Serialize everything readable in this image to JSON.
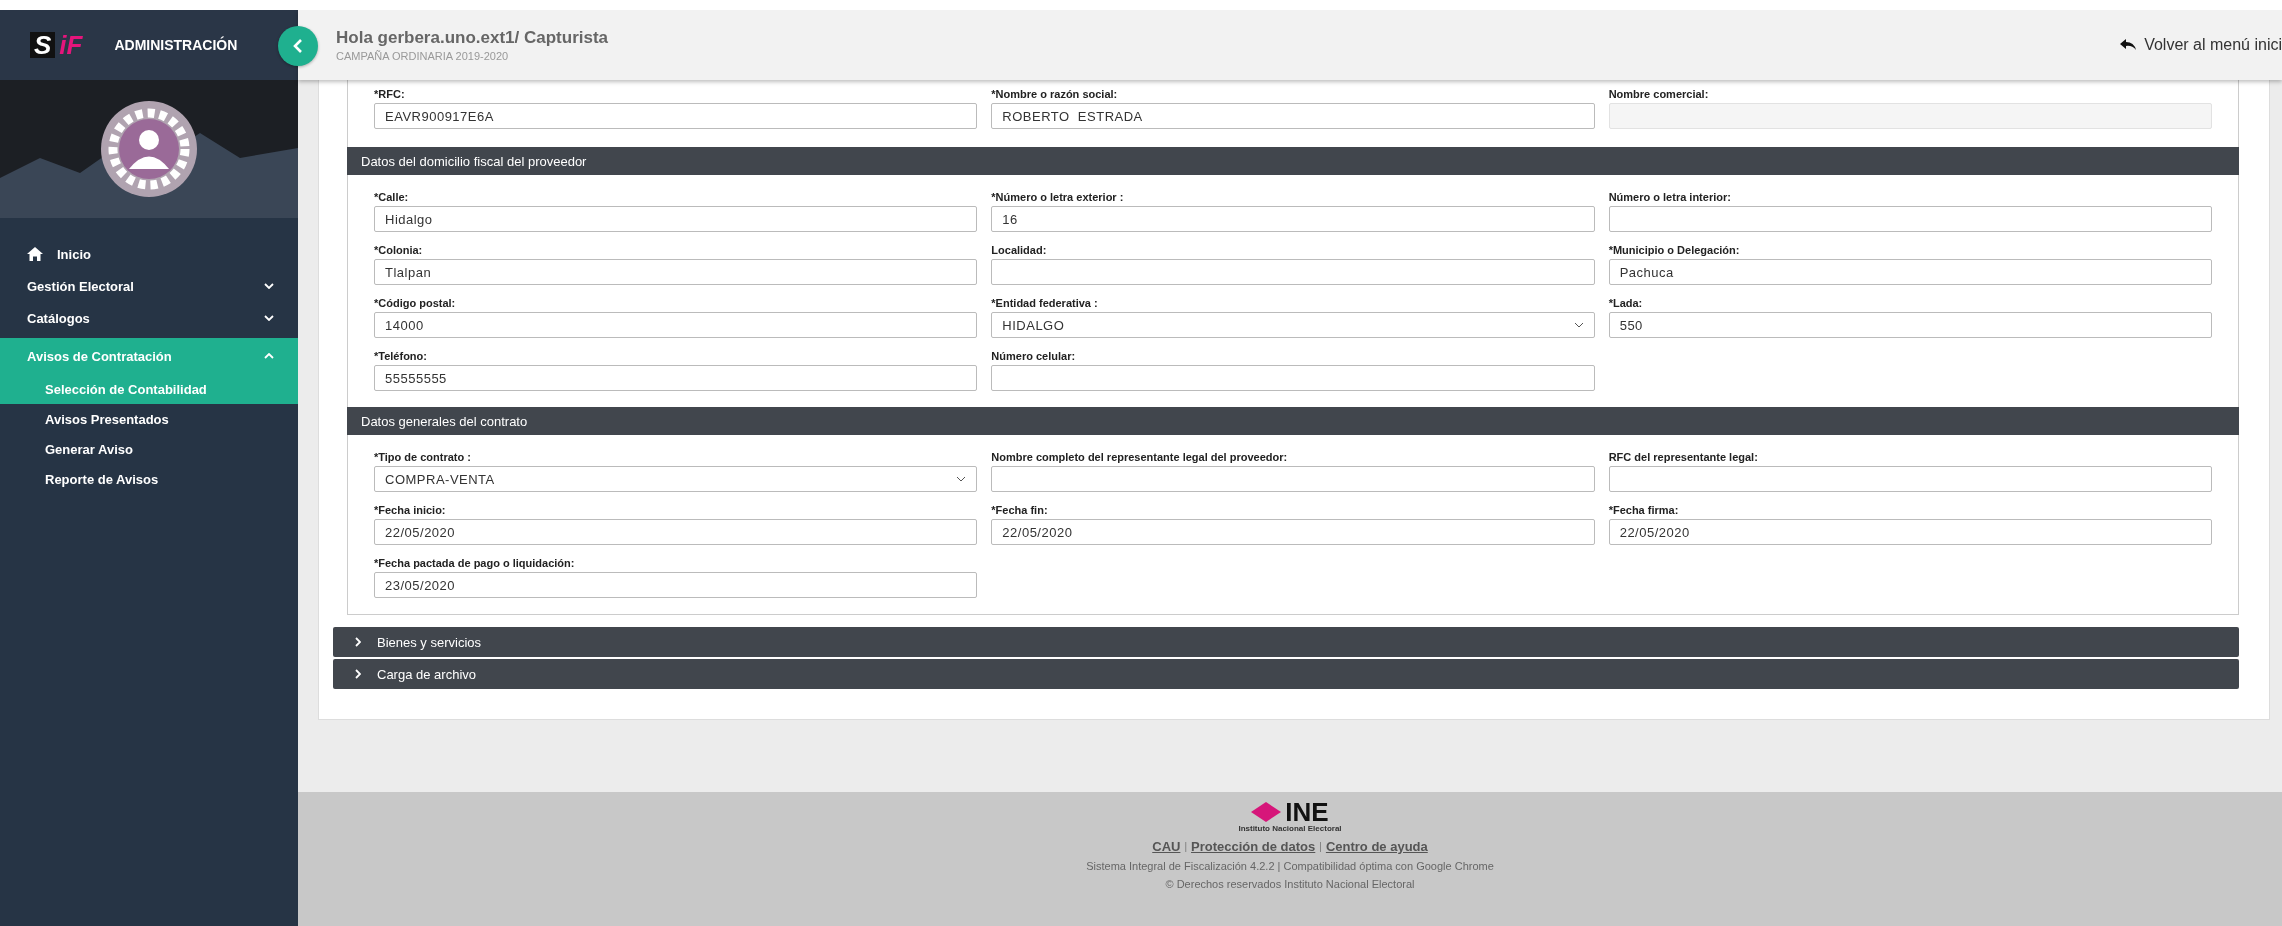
{
  "sidebar": {
    "logo": {
      "mark": "S",
      "accent": "iF"
    },
    "brand": "ADMINISTRACIÓN",
    "menu": [
      {
        "label": "Inicio",
        "kind": "home",
        "selected": false
      },
      {
        "label": "Gestión Electoral",
        "kind": "group",
        "selected": false,
        "expanded": false
      },
      {
        "label": "Catálogos",
        "kind": "group",
        "selected": false,
        "expanded": false
      },
      {
        "label": "Avisos de Contratación",
        "kind": "group",
        "selected": true,
        "expanded": true,
        "children": [
          {
            "label": "Selección de Contabilidad",
            "selected": true
          },
          {
            "label": "Avisos Presentados",
            "selected": false
          },
          {
            "label": "Generar Aviso",
            "selected": false
          },
          {
            "label": "Reporte de Avisos",
            "selected": false
          }
        ]
      }
    ]
  },
  "header": {
    "title": "Hola gerbera.uno.ext1/ Capturista",
    "subtitle": "CAMPAÑA ORDINARIA 2019-2020",
    "back_link": "Volver al menú inici"
  },
  "form": {
    "top_rows": [
      [
        {
          "label": "*RFC:",
          "value": "EAVR900917E6A",
          "kind": "text",
          "disabled": false
        },
        {
          "label": "*Nombre o razón social:",
          "value": "ROBERTO  ESTRADA",
          "kind": "text",
          "disabled": false
        },
        {
          "label": "Nombre comercial:",
          "kind": "text",
          "disabled": true
        }
      ]
    ],
    "sections": [
      {
        "title": "Datos del domicilio fiscal del proveedor",
        "rows": [
          [
            {
              "label": "*Calle:",
              "value": "Hidalgo",
              "kind": "text",
              "disabled": false
            },
            {
              "label": "*Número o letra exterior :",
              "value": "16",
              "kind": "text",
              "disabled": false
            },
            {
              "label": "Número o letra interior:",
              "kind": "text",
              "disabled": false
            }
          ],
          [
            {
              "label": "*Colonia:",
              "value": "Tlalpan",
              "kind": "text",
              "disabled": false
            },
            {
              "label": "Localidad:",
              "kind": "text",
              "disabled": false
            },
            {
              "label": "*Municipio o Delegación:",
              "value": "Pachuca",
              "kind": "text",
              "disabled": false
            }
          ],
          [
            {
              "label": "*Código postal:",
              "value": "14000",
              "kind": "text",
              "disabled": false
            },
            {
              "label": "*Entidad federativa :",
              "value": "HIDALGO",
              "kind": "select",
              "disabled": false
            },
            {
              "label": "*Lada:",
              "value": "550",
              "kind": "text",
              "disabled": false
            }
          ],
          [
            {
              "label": "*Teléfono:",
              "value": "55555555",
              "kind": "text",
              "disabled": false
            },
            {
              "label": "Número celular:",
              "kind": "text",
              "disabled": false
            }
          ]
        ]
      },
      {
        "title": "Datos generales del contrato",
        "rows": [
          [
            {
              "label": "*Tipo de contrato :",
              "value": "COMPRA-VENTA",
              "kind": "select",
              "disabled": false
            },
            {
              "label": "Nombre completo del representante legal del proveedor:",
              "kind": "text",
              "disabled": false
            },
            {
              "label": "RFC del representante legal:",
              "kind": "text",
              "disabled": false
            }
          ],
          [
            {
              "label": "*Fecha inicio:",
              "value": "22/05/2020",
              "kind": "text",
              "disabled": false
            },
            {
              "label": "*Fecha fin:",
              "value": "22/05/2020",
              "kind": "text",
              "disabled": false
            },
            {
              "label": "*Fecha firma:",
              "value": "22/05/2020",
              "kind": "text",
              "disabled": false
            }
          ],
          [
            {
              "label": "*Fecha pactada de pago o liquidación:",
              "value": "23/05/2020",
              "kind": "text",
              "disabled": false
            }
          ]
        ]
      }
    ],
    "panels": [
      {
        "title": "Bienes y servicios",
        "expanded": false
      },
      {
        "title": "Carga de archivo",
        "expanded": false
      }
    ]
  },
  "footer": {
    "logo": {
      "name": "INE",
      "caption": "Instituto Nacional Electoral"
    },
    "links": [
      "CAU",
      "Protección de datos",
      "Centro de ayuda"
    ],
    "separator": "|",
    "version": "Sistema Integral de Fiscalización 4.2.2 | Compatibilidad óptima con Google Chrome",
    "copyright": "© Derechos reservados Instituto Nacional Electoral"
  }
}
